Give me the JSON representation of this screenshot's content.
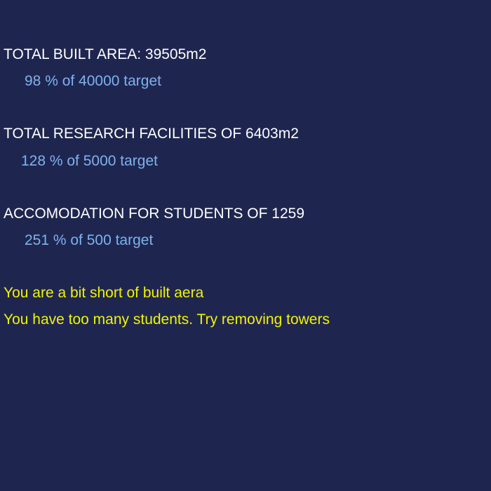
{
  "stats": [
    {
      "heading": "TOTAL BUILT AREA: 39505m2",
      "detail": "98 % of 40000 target"
    },
    {
      "heading": "TOTAL RESEARCH FACILITIES OF 6403m2",
      "detail": "128 % of 5000 target"
    },
    {
      "heading": "ACCOMODATION FOR STUDENTS OF 1259",
      "detail": "251 % of 500 target"
    }
  ],
  "messages": [
    "You are a bit short of built aera",
    "You have too many students. Try removing towers"
  ],
  "colors": {
    "background": "#1e2650",
    "heading": "#ffffff",
    "detail": "#7fb2ec",
    "warning": "#f2f200"
  }
}
